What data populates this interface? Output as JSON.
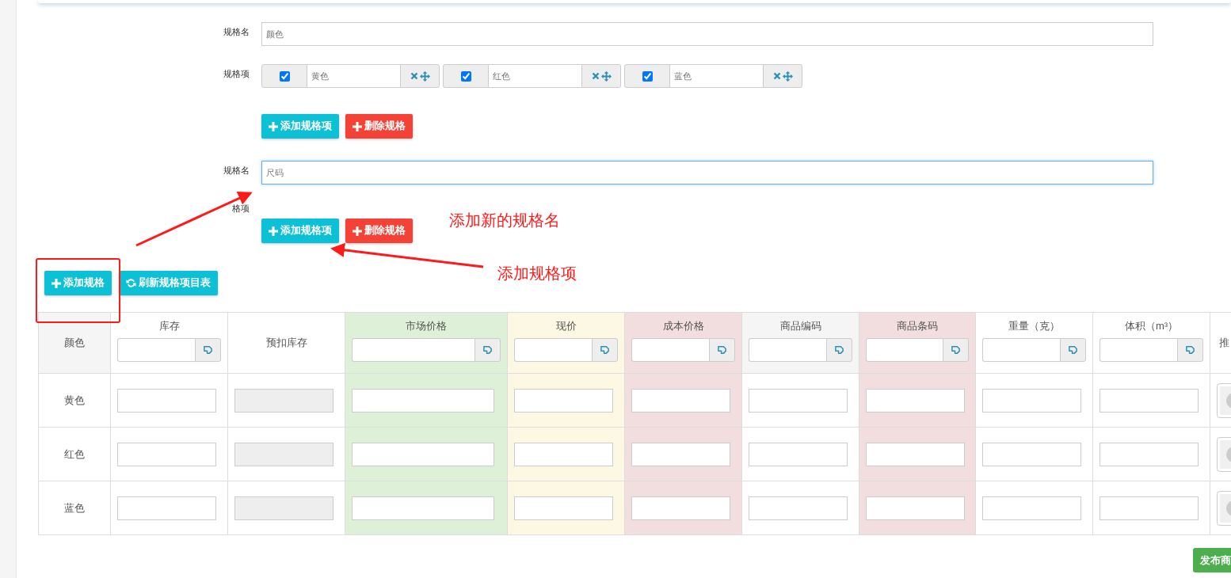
{
  "specs": [
    {
      "name_label": "规格名",
      "value": "颜色",
      "focused": false,
      "items_label": "规格项",
      "items": [
        {
          "checked": true,
          "value": "黄色"
        },
        {
          "checked": true,
          "value": "红色"
        },
        {
          "checked": true,
          "value": "蓝色"
        }
      ],
      "buttons": [
        {
          "kind": "info",
          "label": "添加规格项"
        },
        {
          "kind": "danger",
          "label": "删除规格"
        }
      ]
    },
    {
      "name_label": "规格名",
      "value": "尺码",
      "focused": true,
      "items_label": "格项",
      "buttons": [
        {
          "kind": "info",
          "label": "添加规格项"
        },
        {
          "kind": "danger",
          "label": "删除规格"
        }
      ]
    }
  ],
  "toolbar": [
    {
      "kind": "add",
      "label": "添加规格"
    },
    {
      "kind": "refresh",
      "label": "刷新规格项目表"
    }
  ],
  "table": {
    "columns": [
      {
        "label": "颜色",
        "kind": "name",
        "color": "#f5f5f5"
      },
      {
        "label": "库存",
        "kind": "batch",
        "color": "#ffffff"
      },
      {
        "label": "预扣库存",
        "kind": "disabled",
        "color": "#ffffff"
      },
      {
        "label": "市场价格",
        "kind": "batch",
        "color": "#dff0d8"
      },
      {
        "label": "现价",
        "kind": "batch",
        "color": "#fcf8e3"
      },
      {
        "label": "成本价格",
        "kind": "batch",
        "color": "#f2dede"
      },
      {
        "label": "商品编码",
        "kind": "batch",
        "color": "#f5f5f5"
      },
      {
        "label": "商品条码",
        "kind": "batch",
        "color": "#f2dede"
      },
      {
        "label": "重量（克）",
        "kind": "batch",
        "color": "#ffffff"
      },
      {
        "label": "体积（m³）",
        "kind": "batch",
        "color": "#ffffff"
      },
      {
        "label": "推",
        "kind": "image",
        "color": "#ffffff"
      }
    ],
    "rows": [
      {
        "name": "黄色"
      },
      {
        "name": "红色"
      },
      {
        "name": "蓝色"
      }
    ]
  },
  "publish_button": "发布商",
  "annotations": [
    {
      "text": "添加新的规格名"
    },
    {
      "text": "添加规格项"
    }
  ]
}
